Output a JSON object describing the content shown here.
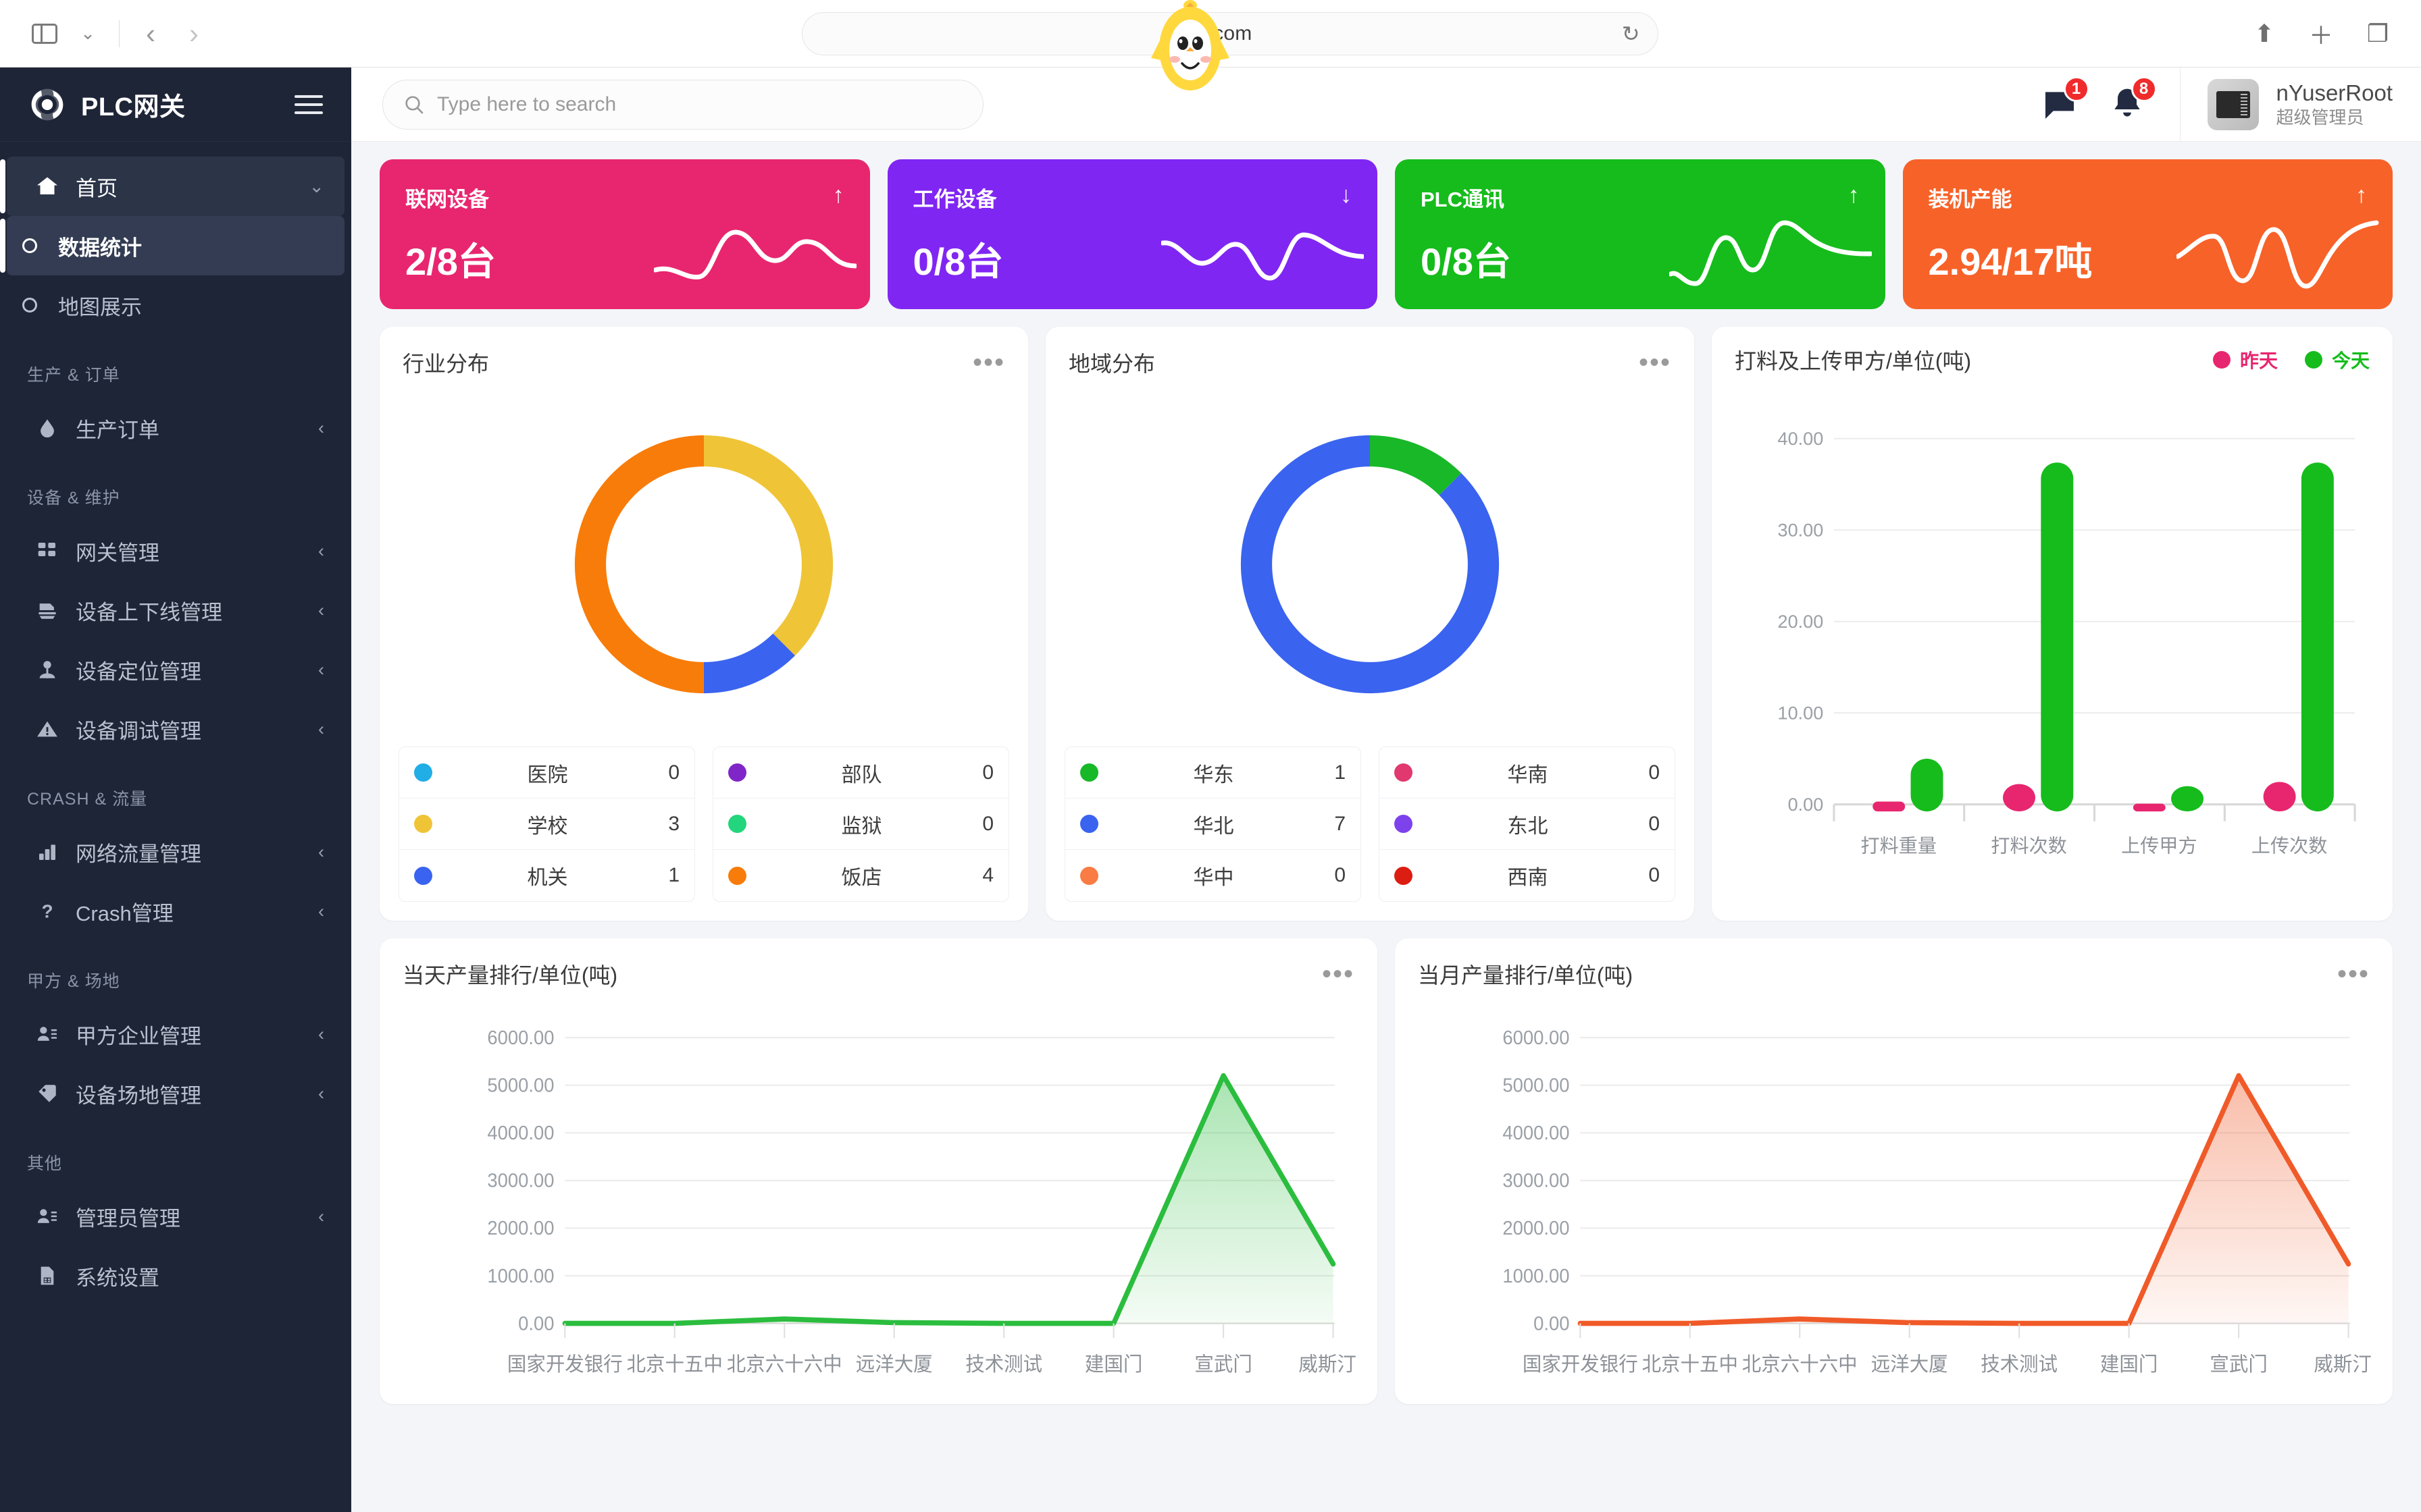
{
  "browser": {
    "url_text": ".com",
    "back_icon": "chevron-left-icon",
    "forward_icon": "chevron-right-icon",
    "reload_icon": "reload-icon",
    "share_icon": "share-icon",
    "new_tab_icon": "plus-icon",
    "tabs_icon": "tabs-icon"
  },
  "sidebar": {
    "brand": "PLC网关",
    "items": [
      {
        "label": "首页",
        "icon": "home-icon",
        "state": "active-parent",
        "chevron": "⌄"
      },
      {
        "label": "数据统计",
        "icon": "circle-icon",
        "state": "active-sub",
        "chevron": ""
      },
      {
        "label": "地图展示",
        "icon": "circle-icon",
        "state": "",
        "chevron": ""
      }
    ],
    "sections": [
      {
        "title": "生产 & 订单",
        "items": [
          {
            "label": "生产订单",
            "icon": "drop-icon",
            "chevron": "‹"
          }
        ]
      },
      {
        "title": "设备 & 维护",
        "items": [
          {
            "label": "网关管理",
            "icon": "grid-icon",
            "chevron": "‹"
          },
          {
            "label": "设备上下线管理",
            "icon": "layers-icon",
            "chevron": "‹"
          },
          {
            "label": "设备定位管理",
            "icon": "pin-icon",
            "chevron": "‹"
          },
          {
            "label": "设备调试管理",
            "icon": "warning-icon",
            "chevron": "‹"
          }
        ]
      },
      {
        "title": "CRASH & 流量",
        "items": [
          {
            "label": "网络流量管理",
            "icon": "bar-chart-icon",
            "chevron": "‹"
          },
          {
            "label": "Crash管理",
            "icon": "question-icon",
            "chevron": "‹"
          }
        ]
      },
      {
        "title": "甲方 & 场地",
        "items": [
          {
            "label": "甲方企业管理",
            "icon": "user-list-icon",
            "chevron": "‹"
          },
          {
            "label": "设备场地管理",
            "icon": "tag-icon",
            "chevron": "‹"
          }
        ]
      },
      {
        "title": "其他",
        "items": [
          {
            "label": "管理员管理",
            "icon": "user-list-icon",
            "chevron": "‹"
          },
          {
            "label": "系统设置",
            "icon": "file-icon",
            "chevron": ""
          }
        ]
      }
    ]
  },
  "topbar": {
    "search_placeholder": "Type here to search",
    "search_value": "",
    "message_badge": "1",
    "bell_badge": "8",
    "user_name": "nYuserRoot",
    "user_role": "超级管理员"
  },
  "kpi_cards": [
    {
      "title": "联网设备",
      "value": "2/8台",
      "arrow": "↑",
      "color": "#e8266f"
    },
    {
      "title": "工作设备",
      "value": "0/8台",
      "arrow": "↓",
      "color": "#8026f3"
    },
    {
      "title": "PLC通讯",
      "value": "0/8台",
      "arrow": "↑",
      "color": "#16bc1c"
    },
    {
      "title": "装机产能",
      "value": "2.94/17吨",
      "arrow": "↑",
      "color": "#f76229"
    }
  ],
  "chart_data": [
    {
      "type": "pie",
      "title": "行业分布",
      "menu_icon": "more-icon",
      "labels": [
        "医院",
        "学校",
        "机关",
        "部队",
        "监狱",
        "饭店"
      ],
      "values": [
        0,
        3,
        1,
        0,
        0,
        4
      ],
      "colors": [
        "#21ade5",
        "#efc437",
        "#3a63ef",
        "#8026c8",
        "#23d57c",
        "#f87c09"
      ],
      "legend": {
        "position": "bottom",
        "left_column": [
          {
            "name": "医院",
            "value": "0",
            "color": "#21ade5"
          },
          {
            "name": "学校",
            "value": "3",
            "color": "#efc437"
          },
          {
            "name": "机关",
            "value": "1",
            "color": "#3a63ef"
          }
        ],
        "right_column": [
          {
            "name": "部队",
            "value": "0",
            "color": "#8026c8"
          },
          {
            "name": "监狱",
            "value": "0",
            "color": "#23d57c"
          },
          {
            "name": "饭店",
            "value": "4",
            "color": "#f87c09"
          }
        ]
      }
    },
    {
      "type": "pie",
      "title": "地域分布",
      "menu_icon": "more-icon",
      "labels": [
        "华东",
        "华北",
        "华中",
        "华南",
        "东北",
        "西南"
      ],
      "values": [
        1,
        7,
        0,
        0,
        0,
        0
      ],
      "colors": [
        "#18b829",
        "#3a63ef",
        "#f87c44",
        "#e0386f",
        "#7e42ed",
        "#dc1d12"
      ],
      "legend": {
        "position": "bottom",
        "left_column": [
          {
            "name": "华东",
            "value": "1",
            "color": "#18b829"
          },
          {
            "name": "华北",
            "value": "7",
            "color": "#3a63ef"
          },
          {
            "name": "华中",
            "value": "0",
            "color": "#f87c44"
          }
        ],
        "right_column": [
          {
            "name": "华南",
            "value": "0",
            "color": "#e0386f"
          },
          {
            "name": "东北",
            "value": "0",
            "color": "#7e42ed"
          },
          {
            "name": "西南",
            "value": "0",
            "color": "#dc1d12"
          }
        ]
      }
    },
    {
      "type": "bar",
      "title": "打料及上传甲方/单位(吨)",
      "categories": [
        "打料重量",
        "打料次数",
        "上传甲方",
        "上传次数"
      ],
      "series": [
        {
          "name": "昨天",
          "values": [
            0.3,
            3.0,
            0.2,
            3.2
          ],
          "color": "#e8266f"
        },
        {
          "name": "今天",
          "values": [
            5.0,
            38.0,
            2.8,
            38.0
          ],
          "color": "#16bc1c"
        }
      ],
      "ylabel": "",
      "xlabel": "",
      "ylim": [
        0,
        40
      ],
      "yticks": [
        "0.00",
        "10.00",
        "20.00",
        "30.00",
        "40.00"
      ],
      "grid": true,
      "legend_position": "top-right"
    },
    {
      "type": "area",
      "title": "当天产量排行/单位(吨)",
      "menu_icon": "more-icon",
      "categories": [
        "国家开发银行",
        "北京十五中",
        "北京六十六中",
        "远洋大厦",
        "技术测试",
        "建国门",
        "宣武门",
        "威斯汀"
      ],
      "values": [
        0,
        0,
        95,
        10,
        0,
        0,
        5200,
        1250
      ],
      "color": "#2bbd3e",
      "ylim": [
        0,
        6000
      ],
      "yticks": [
        "0.00",
        "1000.00",
        "2000.00",
        "3000.00",
        "4000.00",
        "5000.00",
        "6000.00"
      ],
      "grid": true
    },
    {
      "type": "area",
      "title": "当月产量排行/单位(吨)",
      "menu_icon": "more-icon",
      "categories": [
        "国家开发银行",
        "北京十五中",
        "北京六十六中",
        "远洋大厦",
        "技术测试",
        "建国门",
        "宣武门",
        "威斯汀"
      ],
      "values": [
        0,
        0,
        95,
        10,
        0,
        0,
        5200,
        1250
      ],
      "color": "#f05a28",
      "ylim": [
        0,
        6000
      ],
      "yticks": [
        "0.00",
        "1000.00",
        "2000.00",
        "3000.00",
        "4000.00",
        "5000.00",
        "6000.00"
      ],
      "grid": true
    }
  ]
}
